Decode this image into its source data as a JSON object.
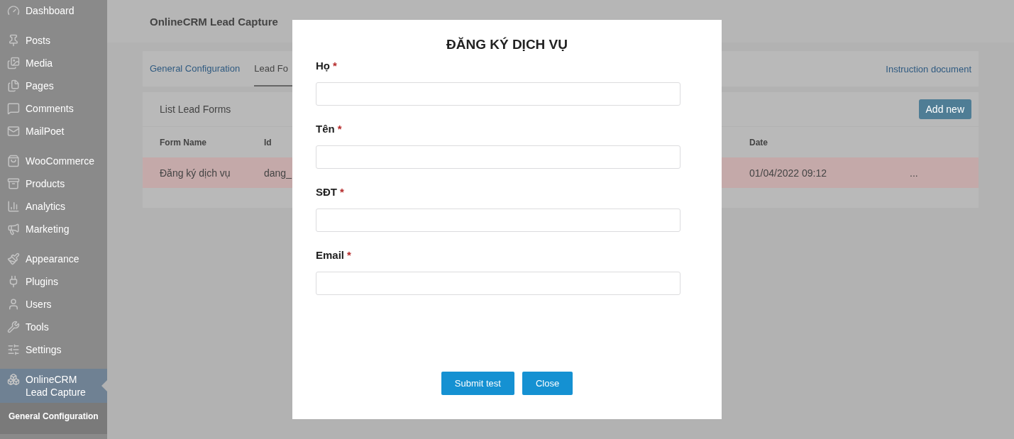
{
  "sidebar": {
    "groups": [
      {
        "items": [
          {
            "label": "Dashboard",
            "selected": false
          }
        ]
      },
      {
        "items": [
          {
            "label": "Posts",
            "selected": false
          },
          {
            "label": "Media",
            "selected": false
          },
          {
            "label": "Pages",
            "selected": false
          },
          {
            "label": "Comments",
            "selected": false
          },
          {
            "label": "MailPoet",
            "selected": false
          }
        ]
      },
      {
        "items": [
          {
            "label": "WooCommerce",
            "selected": false
          },
          {
            "label": "Products",
            "selected": false
          },
          {
            "label": "Analytics",
            "selected": false
          },
          {
            "label": "Marketing",
            "selected": false
          }
        ]
      },
      {
        "items": [
          {
            "label": "Appearance",
            "selected": false
          },
          {
            "label": "Plugins",
            "selected": false
          },
          {
            "label": "Users",
            "selected": false
          },
          {
            "label": "Tools",
            "selected": false
          },
          {
            "label": "Settings",
            "selected": false
          }
        ]
      },
      {
        "items": [
          {
            "label": "OnlineCRM Lead Capture",
            "selected": true,
            "submenu": [
              {
                "label": "General Configuration",
                "selected": true
              }
            ]
          }
        ]
      }
    ]
  },
  "page": {
    "title": "OnlineCRM Lead Capture",
    "tabs": [
      {
        "label": "General Configuration",
        "selected": false
      },
      {
        "label": "Lead Fo",
        "selected": true
      }
    ],
    "help_link": "Instruction document",
    "list": {
      "title": "List Lead Forms",
      "add_button": "Add new",
      "columns": [
        "Form Name",
        "Id",
        "Date"
      ],
      "rows": [
        {
          "cells": [
            "Đăng ký dịch vụ",
            "dang_",
            "01/04/2022 09:12"
          ],
          "actions": "...",
          "highlighted": true
        }
      ]
    }
  },
  "modal": {
    "title": "ĐĂNG KÝ DỊCH VỤ",
    "fields": [
      {
        "label": "Họ",
        "required_mark": "*"
      },
      {
        "label": "Tên",
        "required_mark": "*"
      },
      {
        "label": "SĐT",
        "required_mark": "*"
      },
      {
        "label": "Email",
        "required_mark": "*"
      }
    ],
    "buttons": [
      "Submit test",
      "Close"
    ]
  }
}
